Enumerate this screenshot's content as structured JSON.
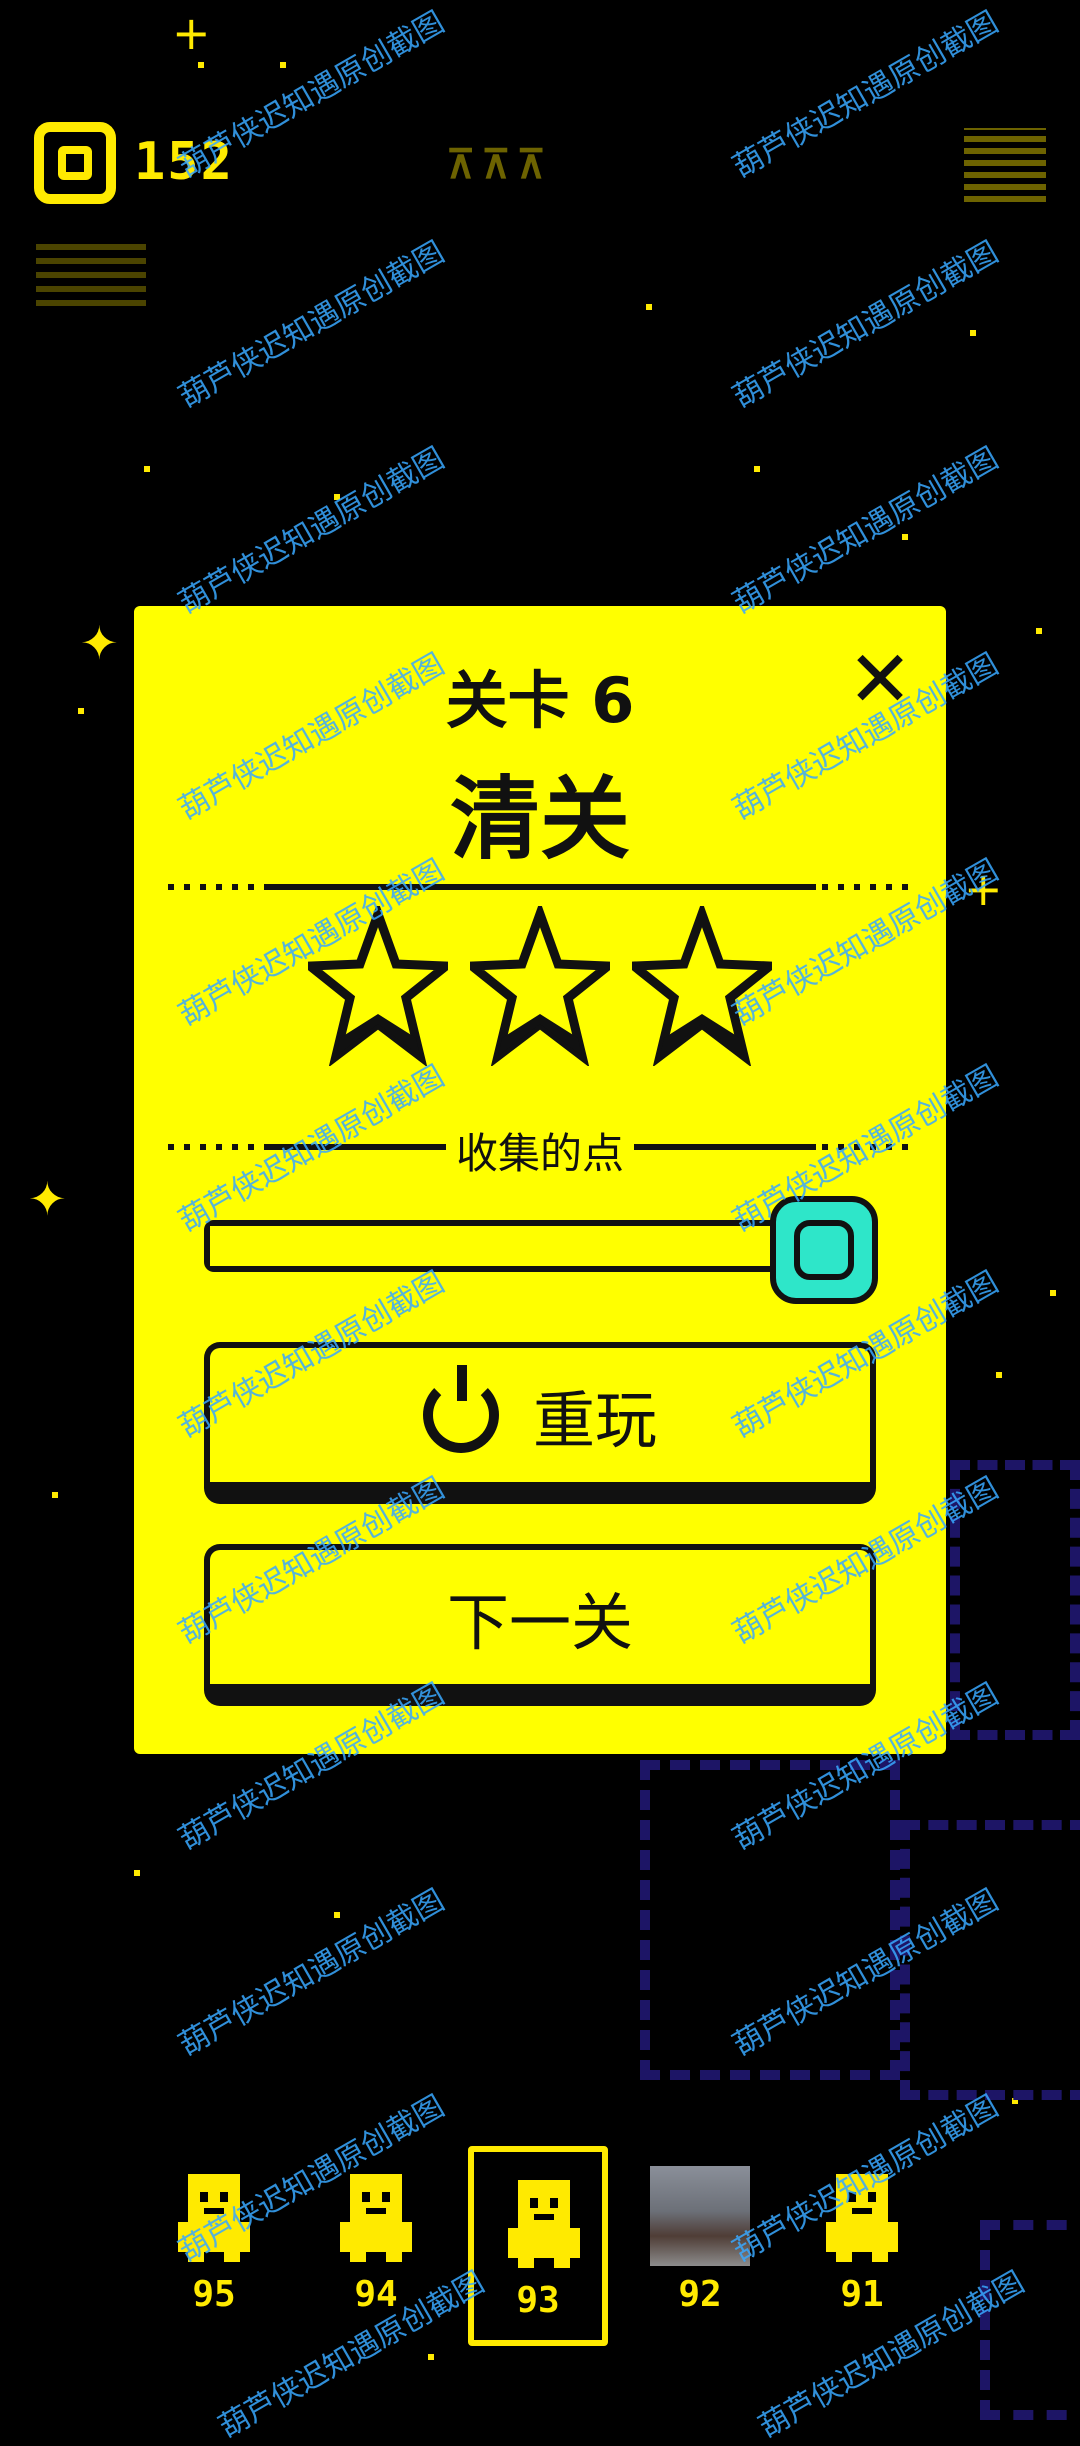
{
  "hud": {
    "coins": "152"
  },
  "dialog": {
    "title": "关卡 6",
    "status": "清关",
    "stars_earned": 3,
    "stars_total": 3,
    "points_label": "收集的点",
    "points_progress": 1.0,
    "replay_label": "重玩",
    "next_label": "下一关"
  },
  "level_slots": [
    {
      "number": "95",
      "icon": "ghost-character-icon"
    },
    {
      "number": "94",
      "icon": "robot-character-icon"
    },
    {
      "number": "93",
      "icon": "masked-character-icon",
      "selected": true
    },
    {
      "number": "92",
      "icon": "photo-thumbnail"
    },
    {
      "number": "91",
      "icon": "skeleton-character-icon"
    }
  ],
  "watermark": "葫芦侠迟知遇原创截图",
  "colors": {
    "accent": "#ffff00",
    "gem": "#2ee6c9",
    "background": "#000000",
    "maze": "#1d1566",
    "watermark": "#39a8ff"
  }
}
